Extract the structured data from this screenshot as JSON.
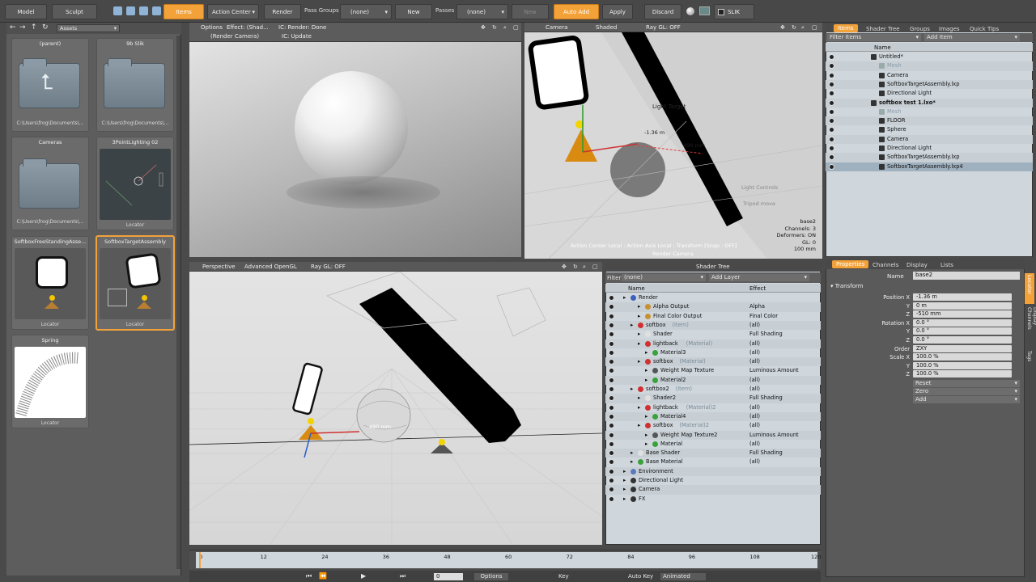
{
  "toolbar": {
    "model": "Model",
    "sculpt": "Sculpt",
    "items": "Items",
    "action_center": "Action Center",
    "render": "Render",
    "pass_groups_label": "Pass Groups",
    "pass_groups_value": "(none)",
    "new": "New",
    "passes_label": "Passes",
    "passes_value": "(none)",
    "new2": "New",
    "auto_add": "Auto Add",
    "apply": "Apply",
    "discard": "Discard",
    "slik": "SLIK"
  },
  "assets": {
    "dropdown": "Assets",
    "items": [
      {
        "name": "(parent)",
        "caption": "C:\\Users\\frog\\Documents\\..."
      },
      {
        "name": "9b Slik",
        "caption": "C:\\Users\\frog\\Documents\\..."
      },
      {
        "name": "Cameras",
        "caption": "C:\\Users\\frog\\Documents\\..."
      },
      {
        "name": "3PointLighting 02",
        "caption": "Locator"
      },
      {
        "name": "SoftboxFreeStandingAsse...",
        "caption": "Locator"
      },
      {
        "name": "SoftboxTargetAssembly",
        "caption": "Locator"
      },
      {
        "name": "Spring",
        "caption": "Locator"
      }
    ]
  },
  "render_vp": {
    "options": "Options",
    "effect": "Effect: (Shad...",
    "ic": "IC: Render: Done",
    "camera": "(Render Camera)",
    "ic2": "IC: Update"
  },
  "camera_vp": {
    "camera": "Camera",
    "shaded": "Shaded",
    "raygl": "Ray GL: OFF",
    "light_target": "Light Target",
    "dist1": "-1.36 m",
    "dist2": "490 mm",
    "light_controls": "Light Controls",
    "tripod": "Tripod move",
    "info": [
      "base2",
      "Channels: 3",
      "Deformers: ON",
      "GL: 0",
      "100 mm"
    ],
    "status": "Action Center Local : Action Axis Local : Transform [Snap : OFF]",
    "render_camera": "Render Camera"
  },
  "persp_vp": {
    "perspective": "Perspective",
    "opengl": "Advanced OpenGL",
    "raygl": "Ray GL: OFF",
    "dist": "490 mm"
  },
  "shader": {
    "title": "Shader Tree",
    "filter": "Filter",
    "filter_value": "(none)",
    "add_layer": "Add Layer",
    "col_name": "Name",
    "col_effect": "Effect",
    "rows": [
      {
        "name": "Render",
        "effect": "",
        "indent": 0,
        "color": "#3f5fbf"
      },
      {
        "name": "Alpha Output",
        "effect": "Alpha",
        "indent": 2,
        "color": "#c8902f"
      },
      {
        "name": "Final Color Output",
        "effect": "Final Color",
        "indent": 2,
        "color": "#c8902f"
      },
      {
        "name": "softbox",
        "tag": "(Item)",
        "effect": "(all)",
        "indent": 1,
        "color": "#d03030"
      },
      {
        "name": "Shader",
        "effect": "Full Shading",
        "indent": 2,
        "color": "#e0e0e0"
      },
      {
        "name": "lightback",
        "tag": "(Material)",
        "effect": "(all)",
        "indent": 2,
        "color": "#d03030"
      },
      {
        "name": "Material3",
        "effect": "(all)",
        "indent": 3,
        "color": "#3aa23a"
      },
      {
        "name": "softbox",
        "tag": "(Material)",
        "effect": "(all)",
        "indent": 2,
        "color": "#d03030"
      },
      {
        "name": "Weight Map Texture",
        "effect": "Luminous Amount",
        "indent": 3,
        "color": "#555"
      },
      {
        "name": "Material2",
        "effect": "(all)",
        "indent": 3,
        "color": "#3aa23a"
      },
      {
        "name": "softbox2",
        "tag": "(Item)",
        "effect": "(all)",
        "indent": 1,
        "color": "#d03030"
      },
      {
        "name": "Shader2",
        "effect": "Full Shading",
        "indent": 2,
        "color": "#e0e0e0"
      },
      {
        "name": "lightback",
        "tag": "(Material)2",
        "effect": "(all)",
        "indent": 2,
        "color": "#d03030"
      },
      {
        "name": "Material4",
        "effect": "(all)",
        "indent": 3,
        "color": "#3aa23a"
      },
      {
        "name": "softbox",
        "tag": "(Material)2",
        "effect": "(all)",
        "indent": 2,
        "color": "#d03030"
      },
      {
        "name": "Weight Map Texture2",
        "effect": "Luminous Amount",
        "indent": 3,
        "color": "#555"
      },
      {
        "name": "Material",
        "effect": "(all)",
        "indent": 3,
        "color": "#3aa23a"
      },
      {
        "name": "Base Shader",
        "effect": "Full Shading",
        "indent": 1,
        "color": "#e0e0e0"
      },
      {
        "name": "Base Material",
        "effect": "(all)",
        "indent": 1,
        "color": "#3aa23a"
      },
      {
        "name": "Environment",
        "effect": "",
        "indent": 0,
        "color": "#5a7ac0"
      },
      {
        "name": "Directional Light",
        "effect": "",
        "indent": 0,
        "color": "#333"
      },
      {
        "name": "Camera",
        "effect": "",
        "indent": 0,
        "color": "#333"
      },
      {
        "name": "FX",
        "effect": "",
        "indent": 0,
        "color": "#333"
      }
    ]
  },
  "items": {
    "tabs": [
      "Items",
      "Shader Tree",
      "Groups",
      "Images",
      "Quick Tips"
    ],
    "filter": "Filter Items",
    "add_item": "Add Item",
    "col_name": "Name",
    "rows": [
      {
        "name": "Untitled*",
        "indent": 0,
        "bold": false,
        "grey": false
      },
      {
        "name": "Mesh",
        "indent": 1,
        "grey": true
      },
      {
        "name": "Camera",
        "indent": 1,
        "grey": false
      },
      {
        "name": "SoftboxTargetAssembly.lxp",
        "indent": 1,
        "grey": false
      },
      {
        "name": "Directional Light",
        "indent": 1,
        "grey": false
      },
      {
        "name": "softbox test 1.lxo*",
        "indent": 0,
        "bold": true,
        "grey": false
      },
      {
        "name": "Mesh",
        "indent": 1,
        "grey": true
      },
      {
        "name": "FLOOR",
        "indent": 1,
        "grey": false
      },
      {
        "name": "Sphere",
        "indent": 1,
        "grey": false
      },
      {
        "name": "Camera",
        "indent": 1,
        "grey": false
      },
      {
        "name": "Directional Light",
        "indent": 1,
        "grey": false
      },
      {
        "name": "SoftboxTargetAssembly.lxp",
        "indent": 1,
        "grey": false
      },
      {
        "name": "SoftboxTargetAssembly.lxp4",
        "indent": 1,
        "grey": false,
        "selected": true
      }
    ]
  },
  "properties": {
    "tabs": [
      "Properties",
      "Channels",
      "Display",
      "Lists"
    ],
    "name_label": "Name",
    "name_value": "base2",
    "section": "Transform",
    "rows": [
      {
        "label": "Position X",
        "value": "-1.36 m"
      },
      {
        "label": "Y",
        "value": "0 m"
      },
      {
        "label": "Z",
        "value": "-510 mm"
      },
      {
        "label": "Rotation X",
        "value": "0.0 °"
      },
      {
        "label": "Y",
        "value": "0.0 °"
      },
      {
        "label": "Z",
        "value": "0.0 °"
      },
      {
        "label": "Order",
        "value": "ZXY"
      },
      {
        "label": "Scale X",
        "value": "100.0 %"
      },
      {
        "label": "Y",
        "value": "100.0 %"
      },
      {
        "label": "Z",
        "value": "100.0 %"
      }
    ],
    "reset": "Reset",
    "zero": "Zero",
    "add": "Add",
    "side_tabs": [
      "Locator",
      "Display Channels",
      "Tags"
    ]
  },
  "timeline": {
    "ticks": [
      "0",
      "12",
      "24",
      "36",
      "48",
      "60",
      "72",
      "84",
      "96",
      "108",
      "120"
    ]
  },
  "bottom": {
    "frame": "0",
    "options": "Options",
    "key": "Key",
    "auto_key": "Auto Key",
    "animated": "Animated"
  }
}
